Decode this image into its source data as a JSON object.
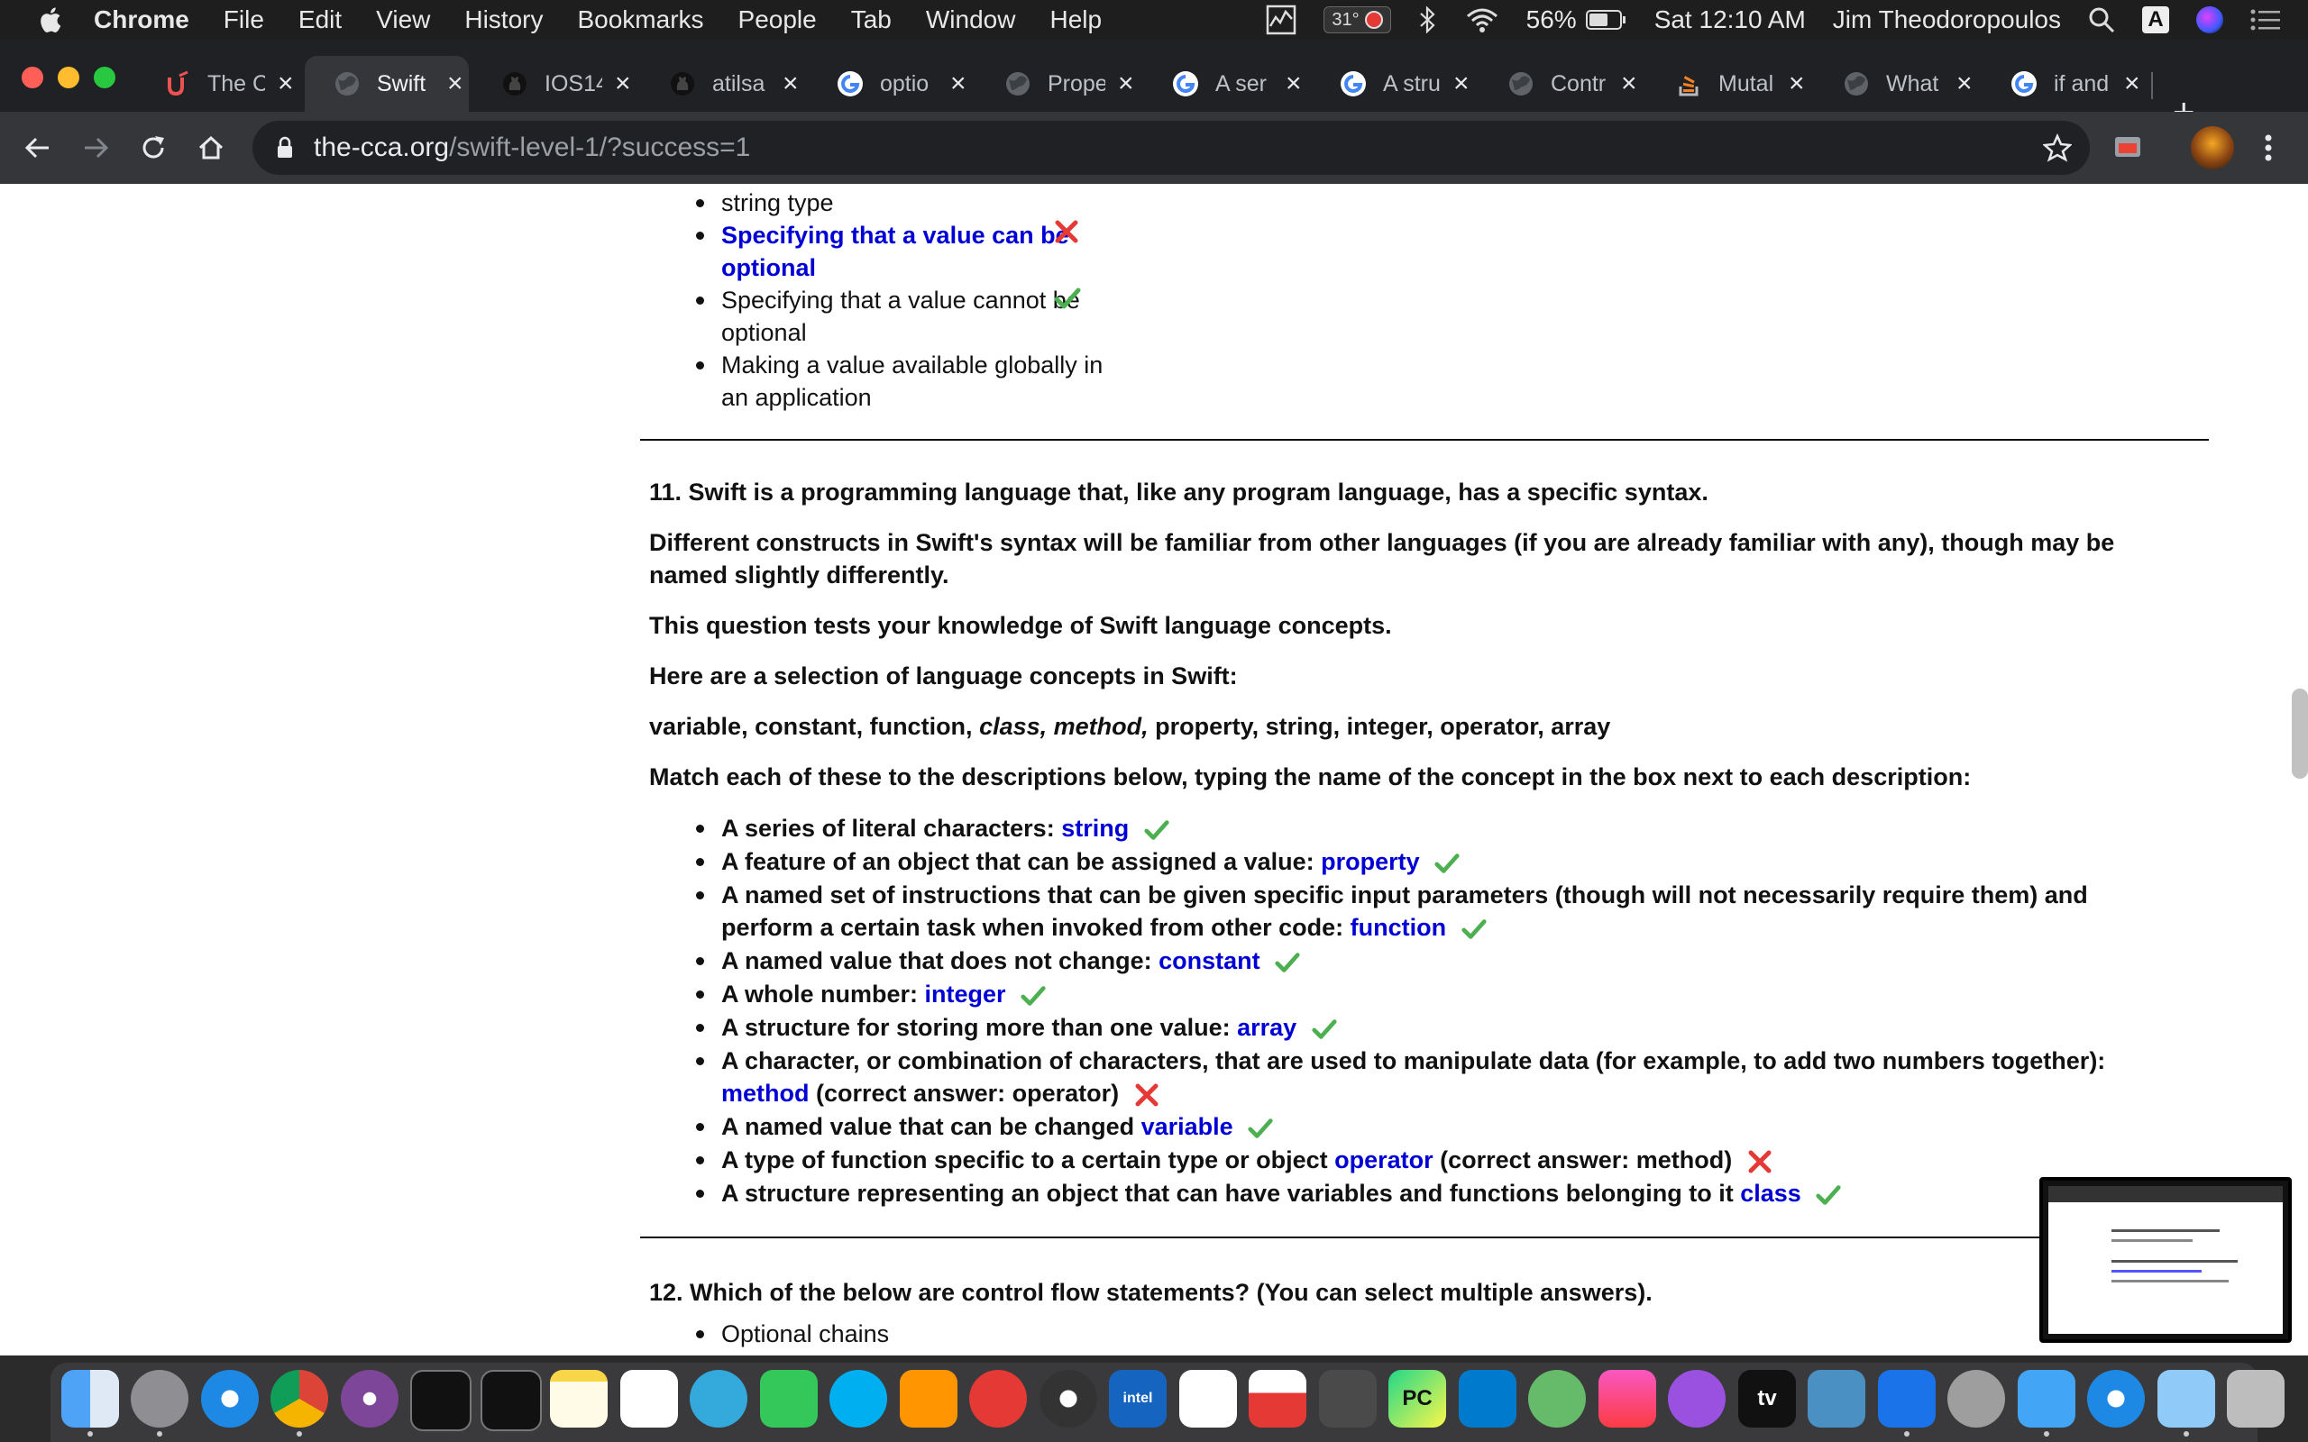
{
  "menubar": {
    "app_name": "Chrome",
    "items": [
      "File",
      "Edit",
      "View",
      "History",
      "Bookmarks",
      "People",
      "Tab",
      "Window",
      "Help"
    ],
    "temperature": "31°",
    "battery": "56%",
    "datetime": "Sat 12:10 AM",
    "user": "Jim Theodoropoulos",
    "input_source": "A"
  },
  "tabs": [
    {
      "title": "The C",
      "icon": "udemy-icon"
    },
    {
      "title": "Swift",
      "icon": "globe-icon",
      "active": true
    },
    {
      "title": "IOS14",
      "icon": "github-icon"
    },
    {
      "title": "atilsa",
      "icon": "github-icon"
    },
    {
      "title": "optio",
      "icon": "google-icon"
    },
    {
      "title": "Prope",
      "icon": "globe-icon"
    },
    {
      "title": "A ser",
      "icon": "google-icon"
    },
    {
      "title": "A stru",
      "icon": "google-icon"
    },
    {
      "title": "Contr",
      "icon": "globe-icon"
    },
    {
      "title": "Mutal",
      "icon": "stackoverflow-icon"
    },
    {
      "title": "What",
      "icon": "globe-icon"
    },
    {
      "title": "if and",
      "icon": "google-icon"
    }
  ],
  "address": {
    "domain": "the-cca.org",
    "path": "/swift-level-1/?success=1"
  },
  "q10_options": [
    {
      "text": "string type",
      "selected": false
    },
    {
      "text": "Specifying that a value can be optional",
      "selected": true,
      "mark": "wrong"
    },
    {
      "text": "Specifying that a value cannot be optional",
      "selected": false,
      "mark": "correct"
    },
    {
      "text": "Making a value available globally in an application",
      "selected": false
    }
  ],
  "q11": {
    "heading": "11. Swift is a programming language that, like any program language, has a specific syntax.",
    "p1": "Different constructs in Swift's syntax will be familiar from other languages (if you are already familiar with any), though may be named slightly differently.",
    "p2": "This question tests your knowledge of Swift language concepts.",
    "p3": "Here are a selection of language concepts in Swift:",
    "concepts": {
      "a": "variable, constant, function, ",
      "b": "class, method,",
      "c": " property, string, integer, operator, array"
    },
    "p4": "Match each of these to the descriptions below, typing the name of the concept in the box next to each description:",
    "items": [
      {
        "desc": "A series of literal characters: ",
        "answer": "string",
        "note": "",
        "mark": "correct"
      },
      {
        "desc": "A feature of an object that can be assigned a value: ",
        "answer": "property",
        "note": "",
        "mark": "correct"
      },
      {
        "desc": "A named set of instructions that can be given specific input parameters (though will not necessarily require them) and perform a certain task when invoked from other code: ",
        "answer": "function",
        "note": "",
        "mark": "correct"
      },
      {
        "desc": "A named value that does not change: ",
        "answer": "constant",
        "note": "",
        "mark": "correct"
      },
      {
        "desc": "A whole number: ",
        "answer": "integer",
        "note": "",
        "mark": "correct"
      },
      {
        "desc": "A structure for storing more than one value: ",
        "answer": "array",
        "note": "",
        "mark": "correct"
      },
      {
        "desc": "A character, or combination of characters, that are used to manipulate data (for example, to add two numbers together): ",
        "answer": "method",
        "note": " (correct answer: operator)",
        "mark": "wrong"
      },
      {
        "desc": "A named value that can be changed ",
        "answer": "variable",
        "note": "",
        "mark": "correct"
      },
      {
        "desc": "A type of function specific to a certain type or object ",
        "answer": "operator",
        "note": " (correct answer: method)",
        "mark": "wrong"
      },
      {
        "desc": "A structure representing an object that can have variables and functions belonging to it ",
        "answer": "class",
        "note": "",
        "mark": "correct"
      }
    ]
  },
  "q12": {
    "heading": "12. Which of the below are control flow statements? (You can select multiple answers).",
    "options": [
      "Optional chains"
    ]
  },
  "dock": {
    "apps": [
      "finder-icon",
      "launchpad-icon",
      "safari-icon",
      "chrome-icon",
      "tor-icon",
      "terminal-icon",
      "activity-monitor-icon",
      "notes-icon",
      "reminders-icon",
      "messages-icon",
      "facetime-icon",
      "skype-icon",
      "home-icon",
      "more-icon",
      "davinci-icon",
      "istat-icon",
      "screen-icon",
      "popcorn-icon",
      "sublime-icon",
      "pycharm-icon",
      "vscode-icon",
      "atom-icon",
      "music-icon",
      "podcasts-icon",
      "tv-icon",
      "virtualbox-icon",
      "xcode-icon",
      "preferences-icon",
      "simulator-icon",
      "quicktime-icon",
      "preview-icon",
      "trash-icon"
    ],
    "tv_label": "tv",
    "pycharm_label": "PC",
    "intel_label": "intel"
  },
  "colors": {
    "answer": "#0000d4",
    "correct": "#4caf50",
    "wrong": "#e53935",
    "chrome_dark": "#202124"
  }
}
